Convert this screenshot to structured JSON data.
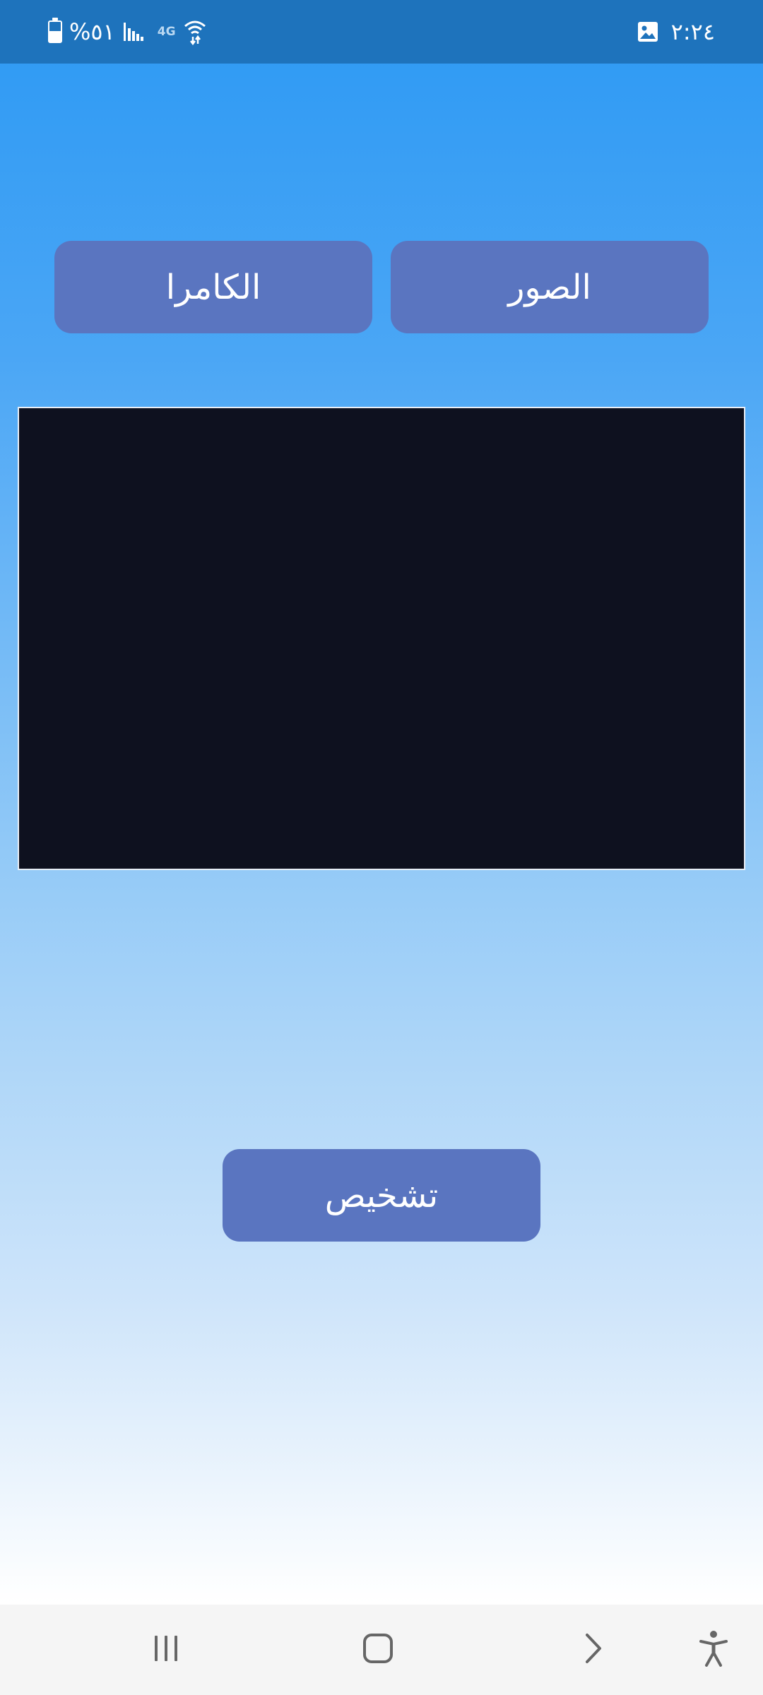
{
  "status_bar": {
    "battery": "%٥١",
    "network": "4G",
    "time": "٢:٢٤",
    "icons": [
      "battery-icon",
      "signal-icon",
      "network-type-icon",
      "wifi-data-icon",
      "gallery-notification-icon"
    ]
  },
  "buttons": {
    "camera_label": "الكامرا",
    "photos_label": "الصور",
    "diagnose_label": "تشخيص"
  },
  "nav_bar": {
    "icons": [
      "recents-icon",
      "home-icon",
      "back-icon",
      "accessibility-icon"
    ]
  },
  "colors": {
    "status_bar": "#1e73bc",
    "button": "#5a75c0",
    "preview": "#0e111f",
    "gradient_top": "#2c99f4",
    "gradient_bottom": "#ffffff",
    "nav_bar": "#f5f5f5"
  }
}
